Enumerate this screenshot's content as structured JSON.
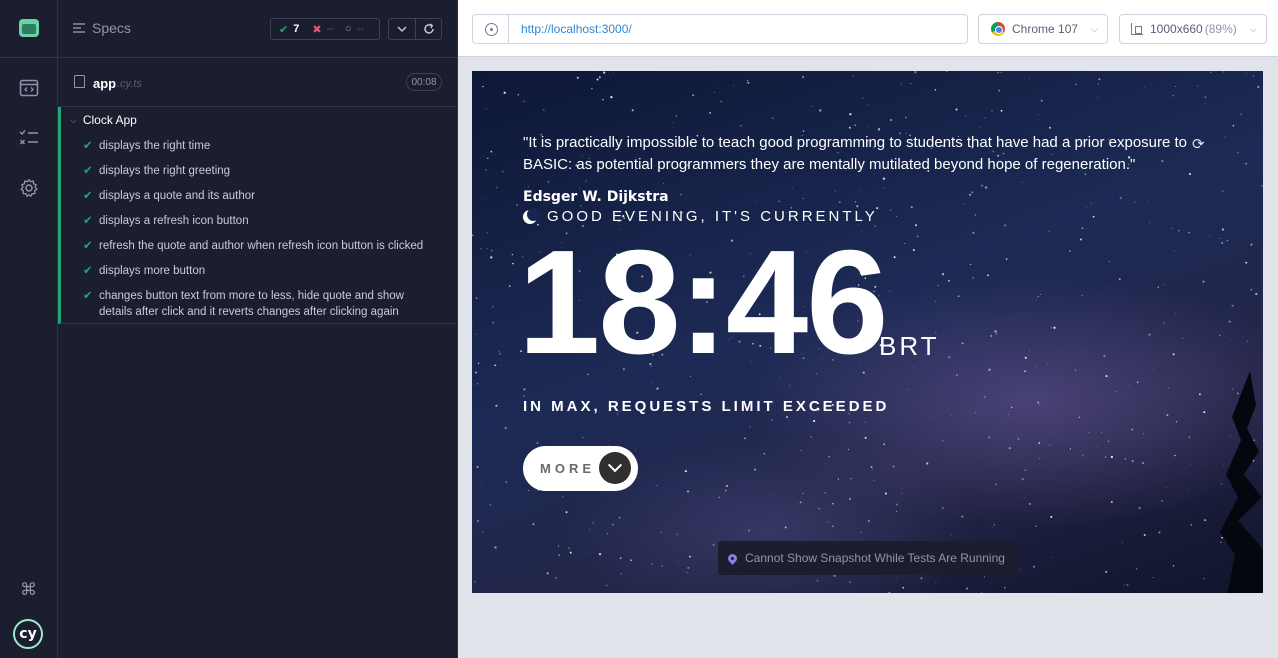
{
  "sidebar_nav": {
    "items": [
      {
        "name": "specs-nav",
        "icon": "code-window-icon"
      },
      {
        "name": "runs-nav",
        "icon": "list-check-icon"
      },
      {
        "name": "settings-nav",
        "icon": "gear-icon"
      }
    ],
    "bottom": {
      "shortcut_icon": "command-icon",
      "logo_text": "cy"
    }
  },
  "reporter": {
    "header_label": "Specs",
    "stats": {
      "passed": "7",
      "failed": "--",
      "pending": "--"
    },
    "spec": {
      "name": "app",
      "ext": ".cy.ts",
      "duration": "00:08"
    },
    "suite": {
      "title": "Clock App",
      "tests": [
        "displays the right time",
        "displays the right greeting",
        "displays a quote and its author",
        "displays a refresh icon button",
        "refresh the quote and author when refresh icon button is clicked",
        "displays more button",
        "changes button text from more to less, hide quote and show details after click and it reverts changes after clicking again"
      ]
    }
  },
  "aut_bar": {
    "url": "http://localhost:3000/",
    "browser": "Chrome 107",
    "viewport": "1000x660",
    "scale": "(89%)"
  },
  "app_preview": {
    "quote": "\"It is practically impossible to teach good programming to students that have had a prior exposure to BASIC: as potential programmers they are mentally mutilated beyond hope of regeneration.\"",
    "author": "Edsger W. Dijkstra",
    "greeting": "GOOD EVENING, IT'S CURRENTLY",
    "time": "18:46",
    "timezone": "BRT",
    "location": "IN MAX, REQUESTS LIMIT EXCEEDED",
    "more_label": "MORE",
    "snapshot_notice": "Cannot Show Snapshot While Tests Are Running"
  },
  "colors": {
    "pass": "#1fa971",
    "fail": "#e45770",
    "accent": "#69d3a7",
    "url": "#3386d4"
  }
}
